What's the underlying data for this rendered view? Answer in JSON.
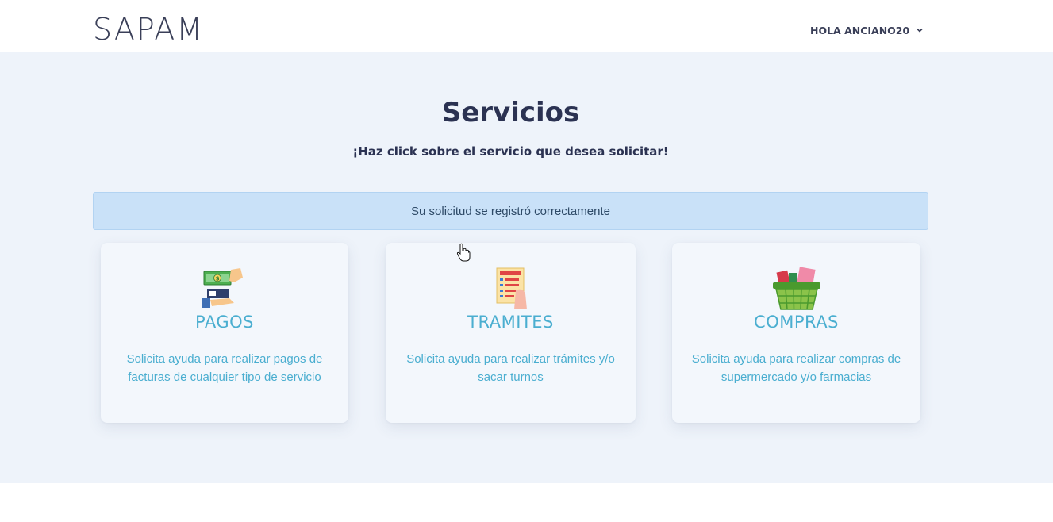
{
  "header": {
    "brand": "SAPAM",
    "user_greeting": "HOLA ANCIANO20"
  },
  "main": {
    "title": "Servicios",
    "subtitle": "¡Haz click sobre el servicio que desea solicitar!",
    "alert": "Su solicitud se registró correctamente"
  },
  "services": [
    {
      "icon": "payment-hand-money-icon",
      "title": "PAGOS",
      "description": "Solicita ayuda para realizar pagos de facturas de cualquier tipo de servicio"
    },
    {
      "icon": "checklist-document-icon",
      "title": "TRAMITES",
      "description": "Solicita ayuda para realizar trámites y/o sacar turnos"
    },
    {
      "icon": "shopping-basket-icon",
      "title": "COMPRAS",
      "description": "Solicita ayuda para realizar compras de supermercado y/o farmacias"
    }
  ],
  "colors": {
    "background": "#eef3fa",
    "accent": "#4aaed0",
    "alert_bg": "#c9e1f8",
    "heading": "#2b3252"
  }
}
